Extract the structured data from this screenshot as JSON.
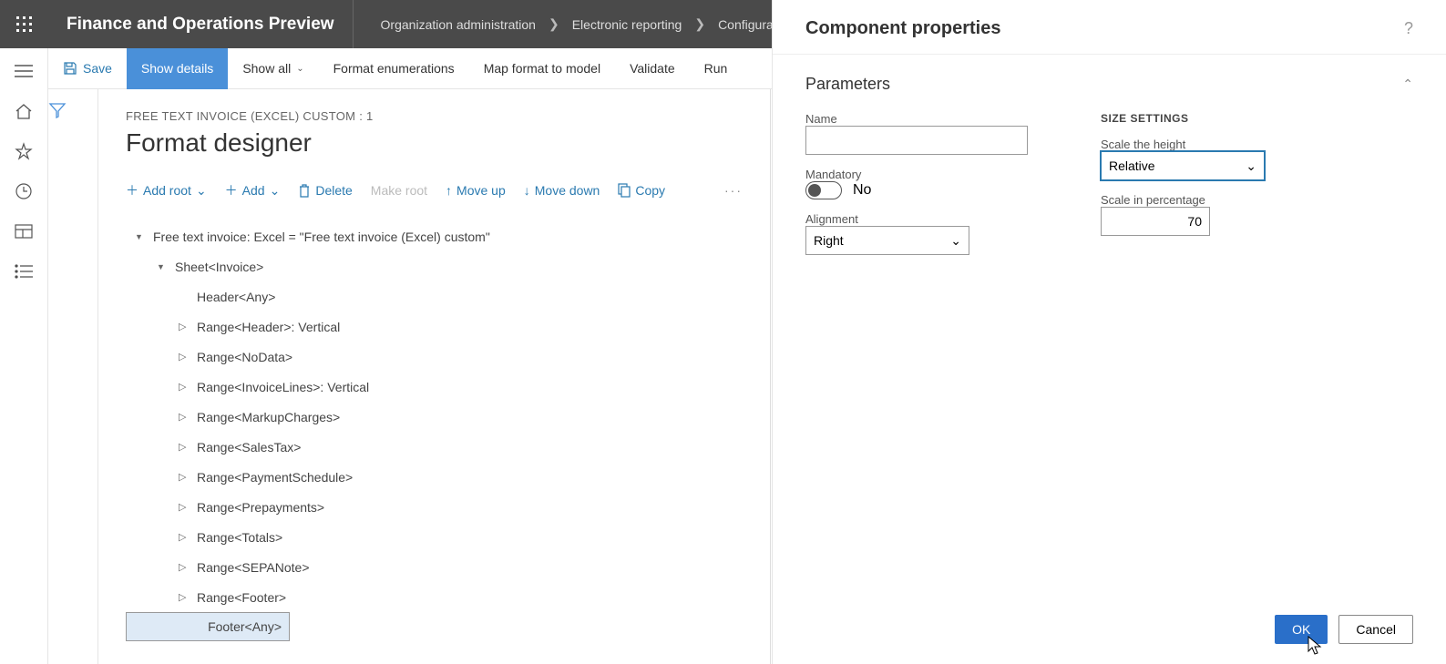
{
  "header": {
    "app_title": "Finance and Operations Preview",
    "breadcrumb": [
      "Organization administration",
      "Electronic reporting",
      "Configurations"
    ]
  },
  "cmdbar": {
    "save": "Save",
    "show_details": "Show details",
    "show_all": "Show all",
    "format_enum": "Format enumerations",
    "map_format": "Map format to model",
    "validate": "Validate",
    "run": "Run"
  },
  "page": {
    "crumb": "FREE TEXT INVOICE (EXCEL) CUSTOM : 1",
    "title": "Format designer",
    "toolbar": {
      "add_root": "Add root",
      "add": "Add",
      "delete": "Delete",
      "make_root": "Make root",
      "move_up": "Move up",
      "move_down": "Move down",
      "copy": "Copy"
    },
    "tree": [
      {
        "indent": 0,
        "caret": "down",
        "label": "Free text invoice: Excel = \"Free text invoice (Excel) custom\""
      },
      {
        "indent": 1,
        "caret": "down",
        "label": "Sheet<Invoice>"
      },
      {
        "indent": 2,
        "caret": "",
        "label": "Header<Any>"
      },
      {
        "indent": 2,
        "caret": "right",
        "label": "Range<Header>: Vertical"
      },
      {
        "indent": 2,
        "caret": "right",
        "label": "Range<NoData>"
      },
      {
        "indent": 2,
        "caret": "right",
        "label": "Range<InvoiceLines>: Vertical"
      },
      {
        "indent": 2,
        "caret": "right",
        "label": "Range<MarkupCharges>"
      },
      {
        "indent": 2,
        "caret": "right",
        "label": "Range<SalesTax>"
      },
      {
        "indent": 2,
        "caret": "right",
        "label": "Range<PaymentSchedule>"
      },
      {
        "indent": 2,
        "caret": "right",
        "label": "Range<Prepayments>"
      },
      {
        "indent": 2,
        "caret": "right",
        "label": "Range<Totals>"
      },
      {
        "indent": 2,
        "caret": "right",
        "label": "Range<SEPANote>"
      },
      {
        "indent": 2,
        "caret": "right",
        "label": "Range<Footer>"
      },
      {
        "indent": 2,
        "caret": "",
        "label": "Footer<Any>",
        "selected": true
      }
    ]
  },
  "panel": {
    "title": "Component properties",
    "section": "Parameters",
    "name_label": "Name",
    "name_value": "",
    "mandatory_label": "Mandatory",
    "mandatory_value": "No",
    "alignment_label": "Alignment",
    "alignment_value": "Right",
    "size_heading": "SIZE SETTINGS",
    "scale_height_label": "Scale the height",
    "scale_height_value": "Relative",
    "scale_pct_label": "Scale in percentage",
    "scale_pct_value": "70",
    "ok": "OK",
    "cancel": "Cancel"
  }
}
